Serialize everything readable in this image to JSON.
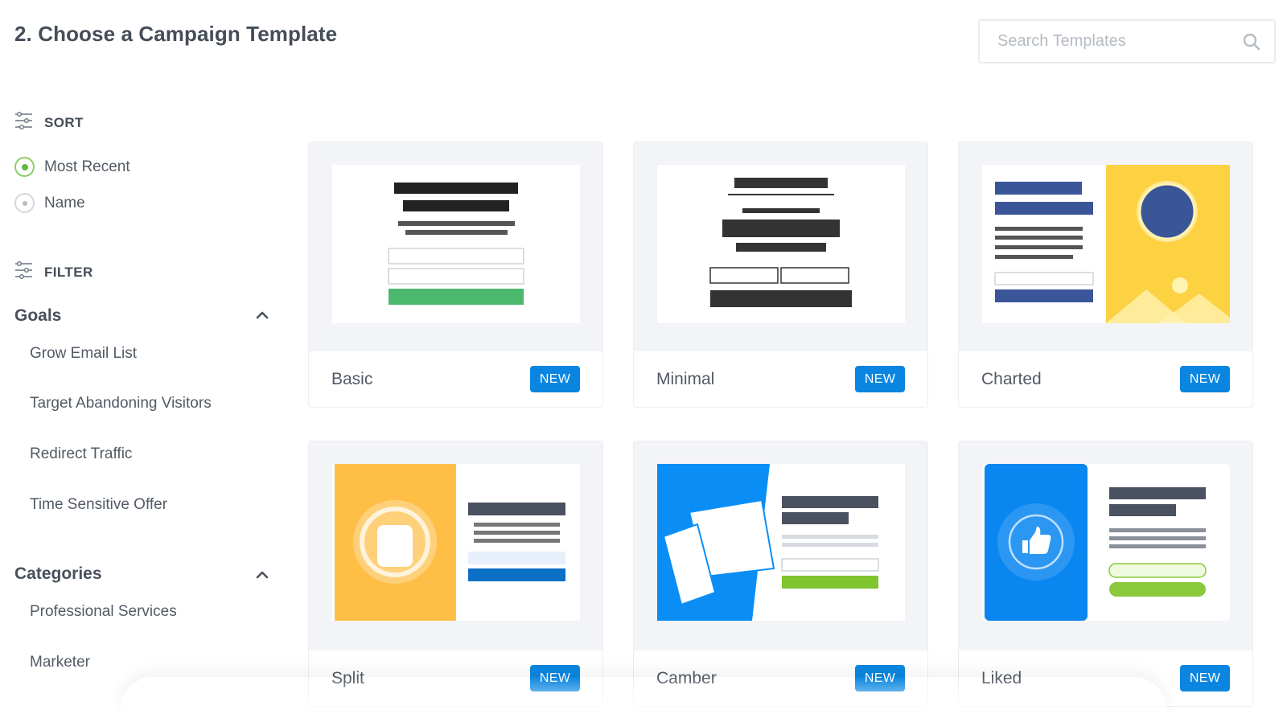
{
  "page": {
    "title": "2. Choose a Campaign Template"
  },
  "search": {
    "placeholder": "Search Templates"
  },
  "sort": {
    "label": "SORT",
    "options": [
      {
        "label": "Most Recent",
        "selected": true
      },
      {
        "label": "Name",
        "selected": false
      }
    ]
  },
  "filter": {
    "label": "FILTER",
    "goals": {
      "title": "Goals",
      "items": [
        "Grow Email List",
        "Target Abandoning Visitors",
        "Redirect Traffic",
        "Time Sensitive Offer"
      ]
    },
    "categories": {
      "title": "Categories",
      "items": [
        "Professional Services",
        "Marketer"
      ]
    }
  },
  "templates": [
    {
      "name": "Basic",
      "badge": "NEW"
    },
    {
      "name": "Minimal",
      "badge": "NEW"
    },
    {
      "name": "Charted",
      "badge": "NEW"
    },
    {
      "name": "Split",
      "badge": "NEW"
    },
    {
      "name": "Camber",
      "badge": "NEW"
    },
    {
      "name": "Liked",
      "badge": "NEW"
    }
  ],
  "colors": {
    "accent": "#0b86e0",
    "selected": "#64b83c",
    "green": "#4bb86d",
    "yellow": "#fcd142",
    "orange": "#ffbf47",
    "blue": "#0a8ef5",
    "navy": "#3a5698"
  }
}
